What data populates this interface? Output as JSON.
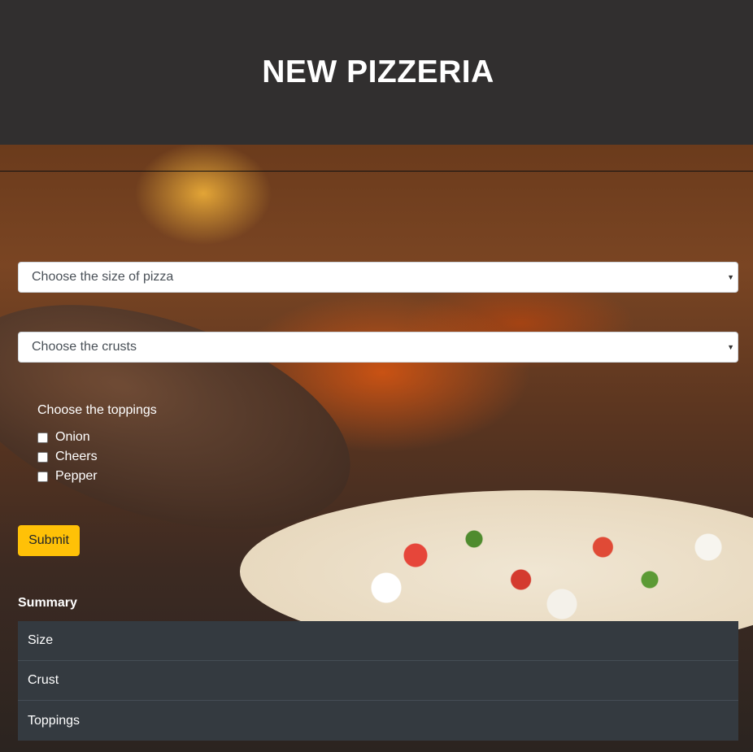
{
  "header": {
    "title": "NEW PIZZERIA"
  },
  "form": {
    "size_select": {
      "selected": "Choose the size of pizza"
    },
    "crust_select": {
      "selected": "Choose the crusts"
    },
    "toppings": {
      "legend": "Choose the toppings",
      "options": [
        {
          "label": "Onion",
          "checked": false
        },
        {
          "label": "Cheers",
          "checked": false
        },
        {
          "label": "Pepper",
          "checked": false
        }
      ]
    },
    "submit_label": "Submit"
  },
  "summary": {
    "title": "Summary",
    "rows": [
      "Size",
      "Crust",
      "Toppings"
    ]
  },
  "colors": {
    "header_bg": "#312f2f",
    "submit_bg": "#ffc107",
    "summary_bg": "#343a40"
  }
}
